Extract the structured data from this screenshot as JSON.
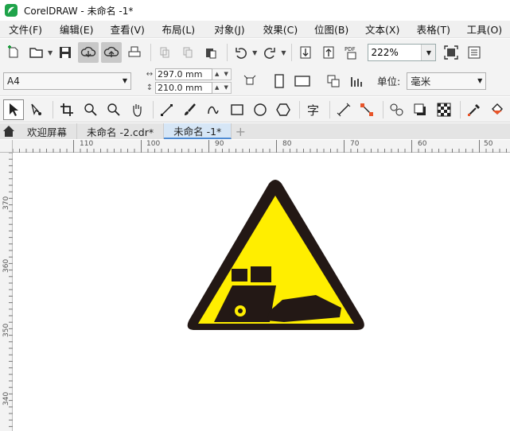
{
  "window": {
    "title": "CorelDRAW - 未命名 -1*"
  },
  "menu": [
    "文件(F)",
    "编辑(E)",
    "查看(V)",
    "布局(L)",
    "对象(J)",
    "效果(C)",
    "位图(B)",
    "文本(X)",
    "表格(T)",
    "工具(O)"
  ],
  "toolbar": {
    "zoom_value": "222%"
  },
  "property_bar": {
    "page_size": "A4",
    "width": "297.0 mm",
    "height": "210.0 mm",
    "unit_label": "单位:",
    "unit_value": "毫米"
  },
  "tabs": [
    {
      "label": "欢迎屏幕",
      "active": false
    },
    {
      "label": "未命名 -2.cdr*",
      "active": false
    },
    {
      "label": "未命名 -1*",
      "active": true
    }
  ],
  "rulers": {
    "horizontal": [
      "110",
      "100",
      "90",
      "80",
      "70",
      "60",
      "50"
    ],
    "vertical": [
      "370",
      "360",
      "350",
      "340"
    ]
  },
  "icons": {
    "new": "new-document-icon",
    "open": "open-folder-icon",
    "save": "save-icon",
    "cloud_down": "cloud-download-icon",
    "cloud_up": "cloud-upload-icon",
    "print": "print-icon",
    "undo": "undo-icon",
    "redo": "redo-icon",
    "import": "import-icon",
    "export": "export-icon",
    "pdf": "pdf-icon",
    "fullscreen": "fullscreen-icon"
  },
  "drawing": {
    "sign_fill": "#ffee00",
    "sign_border": "#231815",
    "symbol_color": "#231815"
  }
}
